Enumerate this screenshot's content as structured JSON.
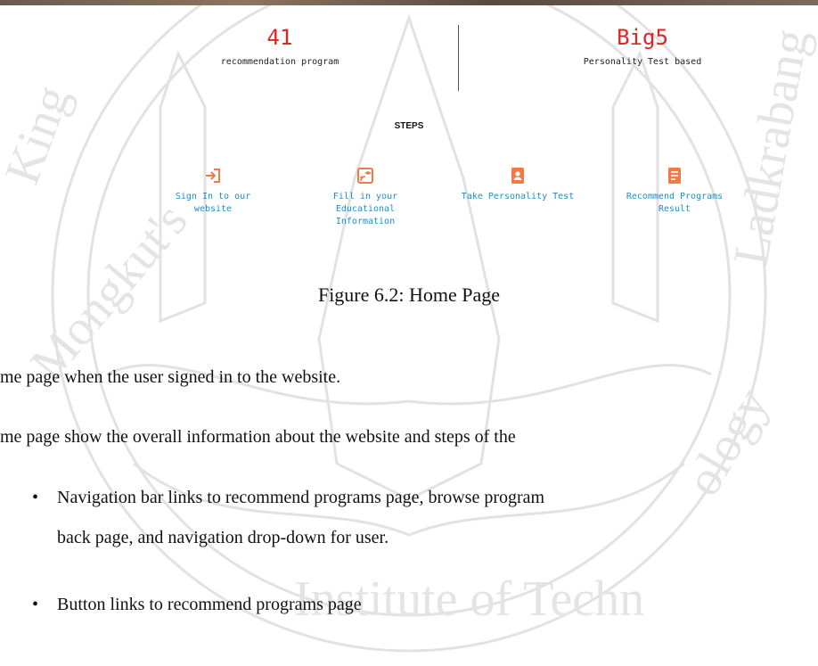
{
  "stats": [
    {
      "value": "41",
      "label": "recommendation program"
    },
    {
      "value": "Big5",
      "label": "Personality Test based"
    }
  ],
  "steps_title": "STEPS",
  "steps": [
    {
      "icon": "sign-in-icon",
      "label_lines": [
        "Sign In to our",
        "website"
      ]
    },
    {
      "icon": "education-icon",
      "label_lines": [
        "Fill in your",
        "Educational",
        "Information"
      ]
    },
    {
      "icon": "personality-icon",
      "label_lines": [
        "Take Personality Test"
      ]
    },
    {
      "icon": "result-list-icon",
      "label_lines": [
        "Recommend Programs",
        "Result"
      ]
    }
  ],
  "figure_caption": "Figure 6.2: Home Page",
  "paragraphs": [
    "me page when the user signed in to the website.",
    "me page show the overall information about the website and steps of the"
  ],
  "bullets": [
    {
      "lines": [
        "Navigation bar links to recommend programs page, browse program",
        "back page, and navigation drop-down for user."
      ]
    },
    {
      "lines": [
        "Button links to recommend programs page"
      ]
    }
  ],
  "colors": {
    "accent_red": "#e02424",
    "step_icon": "#f07a4a",
    "step_text": "#1c8fc9"
  }
}
